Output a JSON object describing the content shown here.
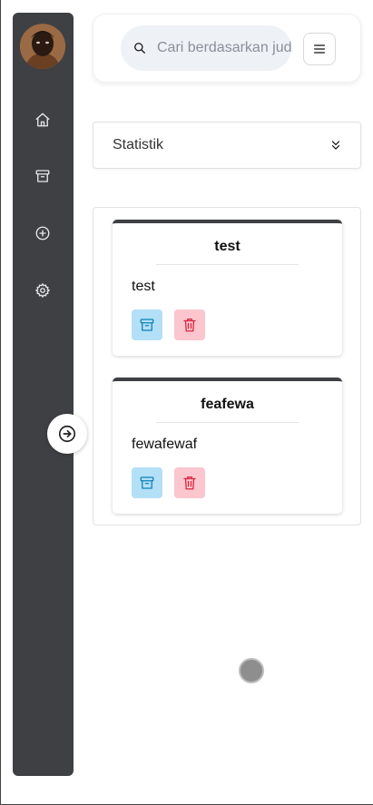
{
  "header": {
    "search_placeholder": "Cari berdasarkan judul"
  },
  "sidebar": {
    "items": [
      {
        "name": "home",
        "icon": "home-icon"
      },
      {
        "name": "archive",
        "icon": "archive-icon"
      },
      {
        "name": "add",
        "icon": "plus-circle-icon"
      },
      {
        "name": "settings",
        "icon": "gear-icon"
      }
    ],
    "toggle_icon": "arrow-right-circle-icon"
  },
  "stats": {
    "label": "Statistik"
  },
  "notes": [
    {
      "title": "test",
      "body": "test"
    },
    {
      "title": "feafewa",
      "body": "fewafewaf"
    }
  ],
  "colors": {
    "sidebar": "#3f4044",
    "archive_bg": "#b3e0f7",
    "archive_icon": "#0e7fb5",
    "delete_bg": "#fbc6ce",
    "delete_icon": "#d9223d"
  }
}
